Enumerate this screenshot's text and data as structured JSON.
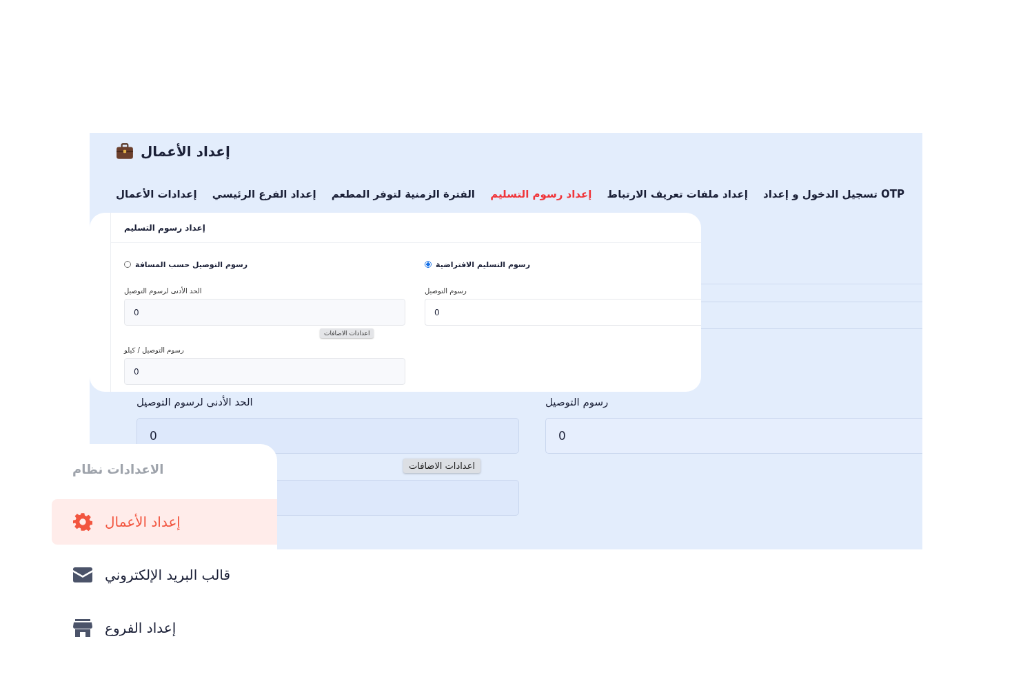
{
  "page_title": "إعداد الأعمال",
  "tabs": [
    {
      "label": "OTP تسجيل الدخول و إعداد",
      "selected": false
    },
    {
      "label": "إعداد ملفات تعريف الارتباط",
      "selected": false
    },
    {
      "label": "إعداد رسوم التسليم",
      "selected": true
    },
    {
      "label": "الفترة الزمنية لتوفر المطعم",
      "selected": false
    },
    {
      "label": "إعداد الفرع الرئيسي",
      "selected": false
    },
    {
      "label": "إعدادات الأعمال",
      "selected": false
    }
  ],
  "background_form": {
    "fields": [
      {
        "label": "رسوم التوصيل",
        "value": "0"
      },
      {
        "label": "الحد الأدنى لرسوم التوصيل",
        "value": "0"
      }
    ],
    "tooltip": "اعدادات الاضافات"
  },
  "delivery_card": {
    "title": "إعداد رسوم التسليم",
    "columns": [
      {
        "option": {
          "label": "رسوم التسليم الافتراضية",
          "selected": true
        },
        "fields": [
          {
            "label": "رسوم التوصيل",
            "value": "0"
          }
        ]
      },
      {
        "option": {
          "label": "رسوم التوصيل حسب المسافة",
          "selected": false
        },
        "fields": [
          {
            "label": "الحد الأدنى لرسوم التوصيل",
            "value": "0"
          },
          {
            "label": "رسوم التوصيل / كيلو",
            "value": "0"
          }
        ]
      }
    ],
    "tooltip": "اعدادات الاضافات"
  },
  "sidebar": {
    "heading": "الاعدادات نظام",
    "items": [
      {
        "label": "إعداد الأعمال",
        "selected": true
      },
      {
        "label": "قالب البريد الإلكتروني",
        "selected": false
      },
      {
        "label": "إعداد الفروع",
        "selected": false
      }
    ]
  }
}
